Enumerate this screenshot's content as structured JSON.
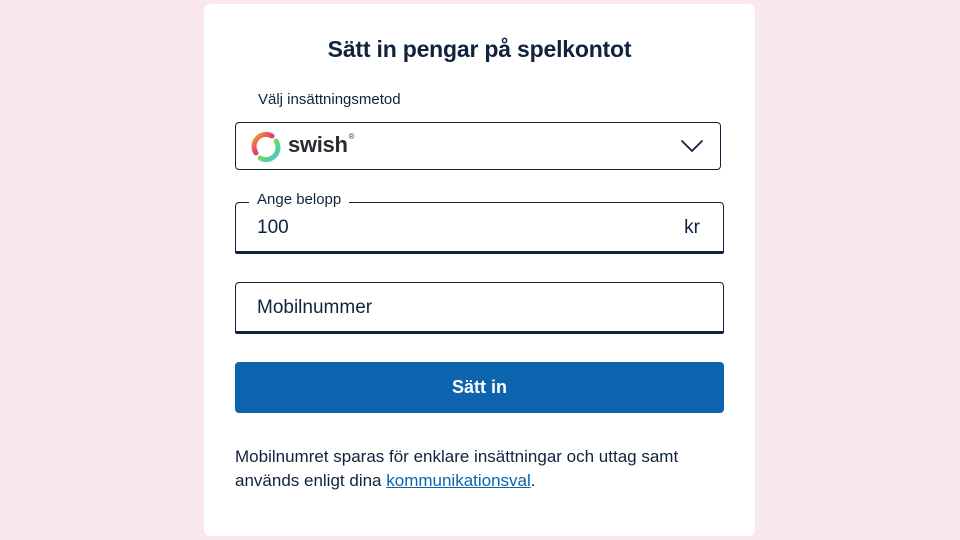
{
  "form": {
    "title": "Sätt in pengar på spelkontot",
    "method": {
      "label": "Välj insättningsmetod",
      "selected": "swish",
      "selected_mark": "®",
      "icons": [
        "swish-logo-icon",
        "chevron-down-icon"
      ]
    },
    "amount": {
      "label": "Ange belopp",
      "value": "100",
      "unit": "kr"
    },
    "phone": {
      "placeholder": "Mobilnummer"
    },
    "submit_label": "Sätt in",
    "info": {
      "text_before": "Mobilnumret sparas för enklare insättningar och uttag samt används enligt dina ",
      "link": "kommunikationsval",
      "text_after": "."
    }
  },
  "colors": {
    "page_background": "#f9e9ec",
    "card_background": "#ffffff",
    "text": "#10233d",
    "primary_button": "#0b64ad",
    "link": "#0b64ad"
  }
}
